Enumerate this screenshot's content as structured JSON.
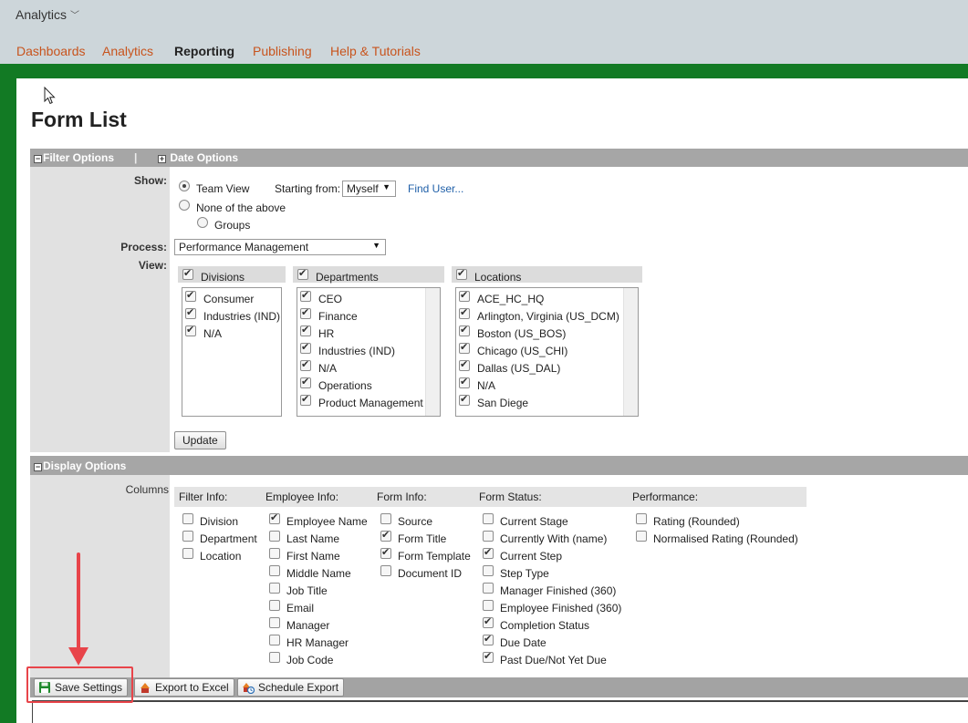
{
  "app": {
    "name": "Analytics"
  },
  "nav": [
    {
      "label": "Dashboards",
      "active": false
    },
    {
      "label": "Analytics",
      "active": false
    },
    {
      "label": "Reporting",
      "active": true
    },
    {
      "label": "Publishing",
      "active": false
    },
    {
      "label": "Help & Tutorials",
      "active": false
    }
  ],
  "page": {
    "title": "Form List"
  },
  "filter_options": {
    "header": "Filter Options",
    "date_header": "Date Options",
    "separator": "|",
    "show_label": "Show:",
    "team_view": "Team View",
    "starting_from_label": "Starting from:",
    "starting_from_value": "Myself",
    "find_user": "Find User...",
    "none_above": "None of the above",
    "groups": "Groups",
    "process_label": "Process:",
    "process_value": "Performance Management",
    "view_label": "View:",
    "divisions": {
      "header": "Divisions",
      "items": [
        "Consumer",
        "Industries (IND)",
        "N/A"
      ]
    },
    "departments": {
      "header": "Departments",
      "items": [
        "CEO",
        "Finance",
        "HR",
        "Industries (IND)",
        "N/A",
        "Operations",
        "Product Management"
      ]
    },
    "locations": {
      "header": "Locations",
      "items": [
        "ACE_HC_HQ",
        "Arlington, Virginia (US_DCM)",
        "Boston (US_BOS)",
        "Chicago (US_CHI)",
        "Dallas (US_DAL)",
        "N/A",
        "San Diege"
      ]
    },
    "update_button": "Update"
  },
  "display_options": {
    "header": "Display Options",
    "columns_label": "Columns",
    "groups": [
      {
        "header": "Filter Info:",
        "items": [
          {
            "label": "Division",
            "checked": false
          },
          {
            "label": "Department",
            "checked": false
          },
          {
            "label": "Location",
            "checked": false
          }
        ]
      },
      {
        "header": "Employee Info:",
        "items": [
          {
            "label": "Employee Name",
            "checked": true
          },
          {
            "label": "Last Name",
            "checked": false
          },
          {
            "label": "First Name",
            "checked": false
          },
          {
            "label": "Middle Name",
            "checked": false
          },
          {
            "label": "Job Title",
            "checked": false
          },
          {
            "label": "Email",
            "checked": false
          },
          {
            "label": "Manager",
            "checked": false
          },
          {
            "label": "HR Manager",
            "checked": false
          },
          {
            "label": "Job Code",
            "checked": false
          }
        ]
      },
      {
        "header": "Form Info:",
        "items": [
          {
            "label": "Source",
            "checked": false
          },
          {
            "label": "Form Title",
            "checked": true
          },
          {
            "label": "Form Template",
            "checked": true
          },
          {
            "label": "Document ID",
            "checked": false
          }
        ]
      },
      {
        "header": "Form Status:",
        "items": [
          {
            "label": "Current Stage",
            "checked": false
          },
          {
            "label": "Currently With (name)",
            "checked": false
          },
          {
            "label": "Current Step",
            "checked": true
          },
          {
            "label": "Step Type",
            "checked": false
          },
          {
            "label": "Manager Finished (360)",
            "checked": false
          },
          {
            "label": "Employee Finished (360)",
            "checked": false
          },
          {
            "label": "Completion Status",
            "checked": true
          },
          {
            "label": "Due Date",
            "checked": true
          },
          {
            "label": "Past Due/Not Yet Due",
            "checked": true
          }
        ]
      },
      {
        "header": "Performance:",
        "items": [
          {
            "label": "Rating (Rounded)",
            "checked": false
          },
          {
            "label": "Normalised Rating (Rounded)",
            "checked": false
          }
        ]
      }
    ]
  },
  "toolbar": {
    "save_settings": "Save Settings",
    "export_excel": "Export to Excel",
    "schedule_export": "Schedule Export"
  },
  "colors": {
    "nav_link": "#c8541d",
    "green": "#127a24",
    "annotation": "#e8444a"
  }
}
